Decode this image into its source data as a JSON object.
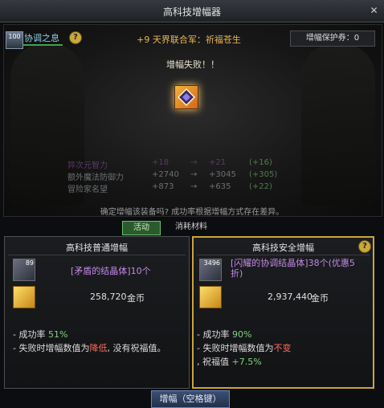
{
  "window": {
    "title": "高科技增幅器",
    "close_icon": "close-icon"
  },
  "synergy": {
    "badge": "100",
    "label": "协调之息"
  },
  "item_name": "+9 天界联合军：祈福苍生",
  "protect_ticket": "增幅保护券：0",
  "result": "增幅失败！！",
  "stats": [
    {
      "name": "异次元智力",
      "before": "+18",
      "after": "+21",
      "delta": "(+16)"
    },
    {
      "name": "额外魔法防御力",
      "before": "+2740",
      "after": "+3045",
      "delta": "(+305)"
    },
    {
      "name": "冒险家名望",
      "before": "+873",
      "after": "+635",
      "delta": "(+22)"
    }
  ],
  "confirm_text": "确定增幅该装备吗? 成功率根据增幅方式存在差异。",
  "tabs": {
    "active": "活动",
    "second": "消耗材料"
  },
  "left_panel": {
    "title": "高科技普通增幅",
    "material_count": "89",
    "material": "[矛盾的结晶体]10个",
    "gold_amount": "258,720",
    "gold_unit": "金币",
    "success_label": "- 成功率",
    "success_value": "51%",
    "fail_pre": "- 失败时增幅数值为",
    "fail_red": "降低",
    "fail_post": ", 没有祝福值。"
  },
  "right_panel": {
    "title": "高科技安全增幅",
    "material_count": "3496",
    "material_line1": "[闪耀的协调结晶体]38个(优惠5",
    "material_line2": "折)",
    "gold_amount": "2,937,440",
    "gold_unit": "金币",
    "success_label": "- 成功率",
    "success_value": "90%",
    "fail_pre": "- 失败时增幅数值为",
    "fail_red": "不变",
    "bless_pre": ", 祝福值",
    "bless_value": "+7.5%"
  },
  "button": {
    "label": "增幅（空格键）"
  },
  "colors": {
    "gold_border": "#c9a53a",
    "success_green": "#7fd37f",
    "warning_red": "#ff6a5a",
    "material_purple": "#c38ae6"
  }
}
